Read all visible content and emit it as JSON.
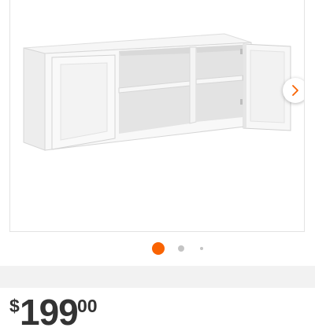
{
  "gallery": {
    "image_subject": "white-wall-cabinet-icon",
    "next_icon": "chevron-right-icon",
    "slide_count": 3,
    "active_slide": 1,
    "colors": {
      "active_dot": "#f96302",
      "inactive_dot": "#c4c4c4",
      "arrow": "#f96302"
    }
  },
  "price": {
    "currency": "$",
    "whole": "199",
    "cents": "00",
    "color": "#333333"
  }
}
